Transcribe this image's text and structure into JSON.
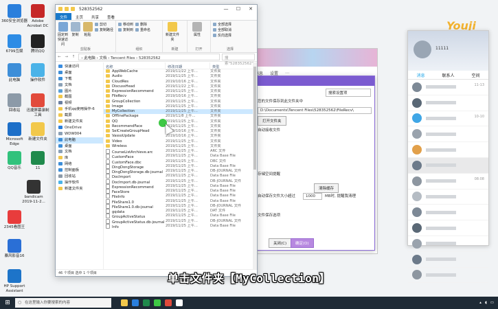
{
  "desktop_icons": [
    {
      "label": "360安全浏览器",
      "color": "#2a7fdc"
    },
    {
      "label": "Adobe Acrobat DC",
      "color": "#c62828"
    },
    {
      "label": "6799互娱",
      "color": "#2d8ce5"
    },
    {
      "label": "腾讯QQ",
      "color": "#222222"
    },
    {
      "label": "此电脑",
      "color": "#3d8ed8"
    },
    {
      "label": "操作软件",
      "color": "#4bb3e8"
    },
    {
      "label": "回收站",
      "color": "#8c9aa8"
    },
    {
      "label": "迅捷屏幕录制工具",
      "color": "#e24a3b"
    },
    {
      "label": "Microsoft Edge",
      "color": "#1d6fc8"
    },
    {
      "label": "新建文件夹",
      "color": "#f2c84b"
    },
    {
      "label": "QQ音乐",
      "color": "#31c27c"
    },
    {
      "label": "11",
      "color": "#1f8a4c"
    },
    {
      "label": "bandicam 2019-11-2...",
      "color": "#333333"
    },
    {
      "label": "2345看图王",
      "color": "#e83c3c"
    },
    {
      "label": "暴风影音16",
      "color": "#2a6fd6"
    },
    {
      "label": "HP Support Assistant",
      "color": "#1d74c9"
    }
  ],
  "explorer": {
    "title": "528352562",
    "window_controls": [
      "—",
      "☐",
      "✕"
    ],
    "ribbon_tabs": [
      "文件",
      "主页",
      "共享",
      "查看"
    ],
    "ribbon": {
      "clipboard": {
        "pin": "固定到快速访问",
        "copy": "复制",
        "paste": "粘贴",
        "copy_path": "复制路径",
        "paste_shortcut": "粘贴快捷方式",
        "cut": "剪切",
        "group": "剪贴板"
      },
      "organize": {
        "move_to": "移动到",
        "copy_to": "复制到",
        "delete": "删除",
        "rename": "重命名",
        "group": "组织"
      },
      "new": {
        "new_folder": "新建文件夹",
        "group": "新建"
      },
      "open": {
        "properties": "属性",
        "group": "打开"
      },
      "select": {
        "all": "全部选择",
        "none": "全部取消",
        "invert": "反向选择",
        "group": "选择"
      }
    },
    "address_path": "›  此电脑  ›  文档  ›  Tencent Files  ›  528352562",
    "search_placeholder": "搜索\"528352562\"",
    "nav_items": [
      {
        "label": "快速访问",
        "color": "#3b8de0"
      },
      {
        "label": "桌面",
        "color": "#3d8ed8"
      },
      {
        "label": "下载",
        "color": "#3d8ed8"
      },
      {
        "label": "文档",
        "color": "#8aa0b6"
      },
      {
        "label": "图片",
        "color": "#5aa0d8"
      },
      {
        "label": "截图",
        "color": "#f2c84b"
      },
      {
        "label": "视频",
        "color": "#6a7fa0"
      },
      {
        "label": "手机qq使用操作-6",
        "color": "#f2c84b"
      },
      {
        "label": "截屏",
        "color": "#f2c84b"
      },
      {
        "label": "新建文件夹",
        "color": "#f2c84b"
      },
      {
        "label": "OneDrive",
        "color": "#2a7fdc"
      },
      {
        "label": "WDW004",
        "color": "#8aa0b6"
      },
      {
        "label": "此电脑",
        "color": "#3d8ed8"
      },
      {
        "label": "桌面",
        "color": "#3d8ed8"
      },
      {
        "label": "文档",
        "color": "#8aa0b6"
      },
      {
        "label": "库",
        "color": "#f2c84b"
      },
      {
        "label": "网络",
        "color": "#3d8ed8"
      },
      {
        "label": "控制面板",
        "color": "#3d8ed8"
      },
      {
        "label": "回收站",
        "color": "#8c9aa8"
      },
      {
        "label": "操作软件",
        "color": "#4bb3e8"
      },
      {
        "label": "新建文件夹",
        "color": "#f2c84b"
      }
    ],
    "columns": [
      "名称",
      "修改日期",
      "类型"
    ],
    "files": [
      {
        "name": "AppWebCache",
        "date": "2019/11/22 上午...",
        "type": "文件夹",
        "folder": true
      },
      {
        "name": "Audio",
        "date": "2019/11/25 上午...",
        "type": "文件夹",
        "folder": true
      },
      {
        "name": "CloudRes",
        "date": "2019/10/16 上午...",
        "type": "文件夹",
        "folder": true
      },
      {
        "name": "DiscussHead",
        "date": "2019/11/22 上午...",
        "type": "文件夹",
        "folder": true
      },
      {
        "name": "ExpressionRecommend",
        "date": "2019/11/25 上午...",
        "type": "文件夹",
        "folder": true
      },
      {
        "name": "FileRecv",
        "date": "2019/10/16 上午...",
        "type": "文件夹",
        "folder": true
      },
      {
        "name": "GroupCollection",
        "date": "2019/11/25 上午...",
        "type": "文件夹",
        "folder": true
      },
      {
        "name": "Image",
        "date": "2019/11/25 上午...",
        "type": "文件夹",
        "folder": true
      },
      {
        "name": "MyCollection",
        "date": "2019/11/25 上午...",
        "type": "文件夹",
        "folder": true,
        "selected": true
      },
      {
        "name": "OfflinePackage",
        "date": "2019/11/8 上午...",
        "type": "文件夹",
        "folder": true
      },
      {
        "name": "QQ",
        "date": "2019/11/25 上午...",
        "type": "文件夹",
        "folder": true
      },
      {
        "name": "RecommendFace",
        "date": "2019/11/25 上午...",
        "type": "文件夹",
        "folder": true
      },
      {
        "name": "SelCreateGroupHead",
        "date": "2019/10/16 上午...",
        "type": "文件夹",
        "folder": true
      },
      {
        "name": "VassoUpdate",
        "date": "2019/10/16 上午...",
        "type": "文件夹",
        "folder": true
      },
      {
        "name": "Video",
        "date": "2019/11/25 上午...",
        "type": "文件夹",
        "folder": true
      },
      {
        "name": "Wireless",
        "date": "2019/11/25 上午...",
        "type": "文件夹",
        "folder": true
      },
      {
        "name": "CourseListArchieve.arc",
        "date": "2019/11/25 上午...",
        "type": "ARC 文件",
        "folder": false
      },
      {
        "name": "CustomFace",
        "date": "2019/11/25 上午...",
        "type": "Data Base File",
        "folder": false
      },
      {
        "name": "CustomFace.dbc",
        "date": "2019/11/25 上午...",
        "type": "DBC 文件",
        "folder": false
      },
      {
        "name": "DingDongStorage",
        "date": "2019/11/25 上午...",
        "type": "Data Base File",
        "folder": false
      },
      {
        "name": "DingDongStorage.db-journal",
        "date": "2019/11/25 上午...",
        "type": "DB-JOURNAL 文件",
        "folder": false
      },
      {
        "name": "DocImport",
        "date": "2019/11/25 上午...",
        "type": "Data Base File",
        "folder": false
      },
      {
        "name": "DocImport.db-journal",
        "date": "2019/11/25 上午...",
        "type": "DB-JOURNAL 文件",
        "folder": false
      },
      {
        "name": "ExpressionRecommend",
        "date": "2019/11/25 上午...",
        "type": "Data Base File",
        "folder": false
      },
      {
        "name": "FaceStore",
        "date": "2019/11/25 上午...",
        "type": "Data Base File",
        "folder": false
      },
      {
        "name": "FileInfo",
        "date": "2019/11/25 上午...",
        "type": "Data Base File",
        "folder": false
      },
      {
        "name": "FileShare1.0",
        "date": "2019/11/25 上午...",
        "type": "Data Base File",
        "folder": false
      },
      {
        "name": "FileShare1.0.db-journal",
        "date": "2019/11/25 上午...",
        "type": "DB-JOURNAL 文件",
        "folder": false
      },
      {
        "name": "gqdata",
        "date": "2019/11/25 上午...",
        "type": "DAT 文件",
        "folder": false
      },
      {
        "name": "GroupActiveStatus",
        "date": "2019/11/25 上午...",
        "type": "Data Base File",
        "folder": false
      },
      {
        "name": "GroupActiveStatus.db-journal",
        "date": "2019/11/25 上午...",
        "type": "DB-JOURNAL 文件",
        "folder": false
      },
      {
        "name": "Info",
        "date": "2019/11/25 上午...",
        "type": "Data Base File",
        "folder": false
      }
    ],
    "status": "46 个项目    选中 1 个项目"
  },
  "qq_settings": {
    "nav": [
      "消息",
      "设置",
      "⋯"
    ],
    "search_placeholder": "搜索设置项",
    "lines": [
      "您的文件保存到此文件夹中",
      "D:\\Documents\\Tencent Files\\528352562\\FileRecv\\",
      "打开文件夹",
      "自动接收文件",
      "存储空间提醒",
      "清除缓存",
      "自动保存文件大小超过",
      "MB时, 提醒我清理",
      "文件保存选项"
    ],
    "threshold_value": "1000",
    "cancel_label": "关闭(C)",
    "ok_label": "确定(O)"
  },
  "qq_panel": {
    "number": "11111",
    "tabs": [
      "消息",
      "联系人",
      "空间"
    ],
    "times": [
      "11-13",
      "",
      "10-10",
      "",
      "",
      "",
      "08:08",
      "",
      "",
      "",
      "",
      "",
      ""
    ]
  },
  "logo_text": "Youji",
  "caption": "单击文件夹【MyCollection】",
  "taskbar": {
    "search_placeholder": "在这里输入你要搜索的内容",
    "app_colors": [
      "#f2c84b",
      "#2a7fdc",
      "#1f8a4c",
      "#3ec845",
      "#e04a3b",
      "#ffffff"
    ]
  }
}
